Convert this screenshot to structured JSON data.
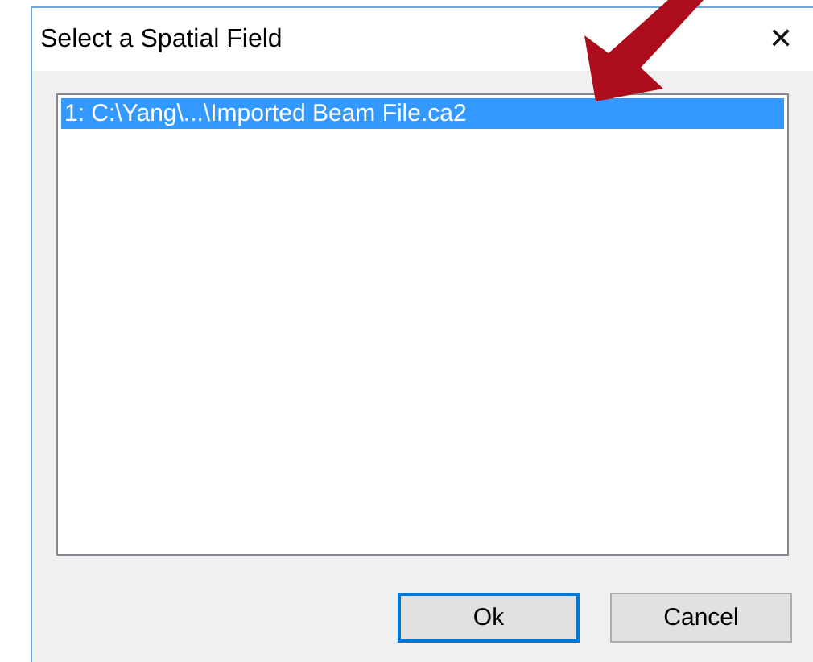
{
  "window": {
    "title": "Select a Spatial Field",
    "close": "✕"
  },
  "list": {
    "items": [
      {
        "label": "1: C:\\Yang\\...\\Imported Beam File.ca2",
        "selected": true
      }
    ]
  },
  "buttons": [
    {
      "label": "Ok",
      "default": true
    },
    {
      "label": "Cancel",
      "default": false
    }
  ],
  "annotation": {
    "kind": "arrow"
  }
}
